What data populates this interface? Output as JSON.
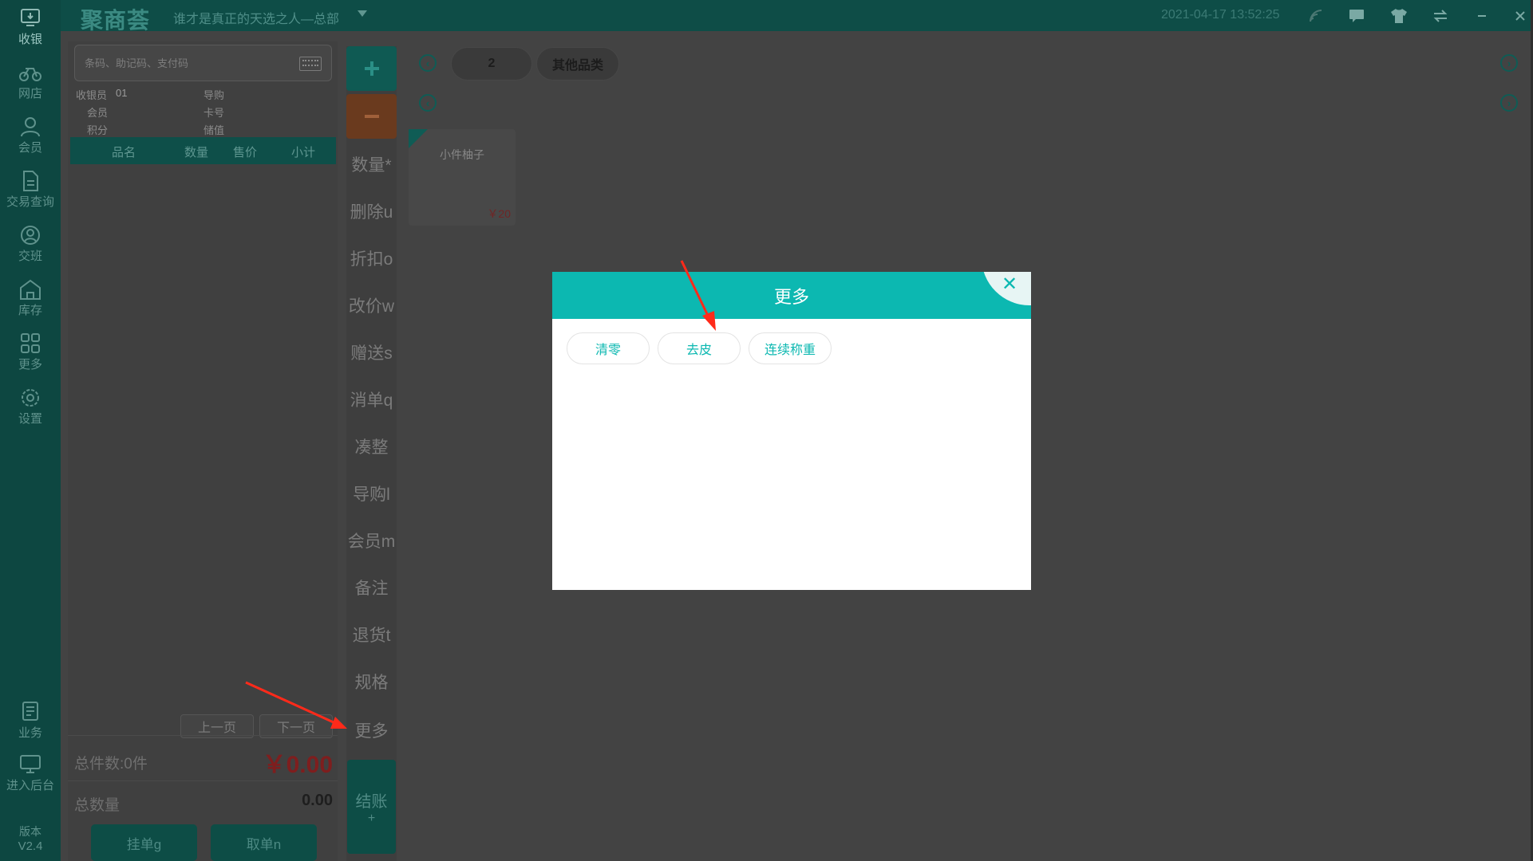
{
  "app": {
    "logo": "聚商荟",
    "store": "谁才是真正的天选之人—总部",
    "datetime": "2021-04-17 13:52:25"
  },
  "nav": [
    {
      "label": "收银",
      "icon": "cashier-icon"
    },
    {
      "label": "网店",
      "icon": "bike-icon"
    },
    {
      "label": "会员",
      "icon": "member-icon"
    },
    {
      "label": "交易查询",
      "icon": "document-icon"
    },
    {
      "label": "交班",
      "icon": "shift-icon"
    },
    {
      "label": "库存",
      "icon": "warehouse-icon"
    },
    {
      "label": "更多",
      "icon": "grid-icon"
    },
    {
      "label": "设置",
      "icon": "gear-icon"
    },
    {
      "label": "业务",
      "icon": "business-icon"
    },
    {
      "label": "进入后台",
      "icon": "monitor-icon"
    }
  ],
  "version": {
    "label": "版本",
    "value": "V2.4"
  },
  "cart": {
    "search_placeholder": "条码、助记码、支付码",
    "cashier_label": "收银员",
    "cashier_value": "01",
    "guide_label": "导购",
    "member_label": "会员",
    "card_label": "卡号",
    "points_label": "积分",
    "balance_label": "储值",
    "columns": [
      "品名",
      "数量",
      "售价",
      "小计"
    ],
    "prev_page": "上一页",
    "next_page": "下一页",
    "total_count": "总件数:0件",
    "total_price": "￥0.00",
    "total_qty_label": "总数量",
    "total_qty": "0.00",
    "hold_btn": "挂单g",
    "retrieve_btn": "取单n"
  },
  "actions": {
    "plus": "+",
    "minus": "−",
    "items": [
      "数量*",
      "删除u",
      "折扣o",
      "改价w",
      "赠送s",
      "消单q",
      "凑整",
      "导购l",
      "会员m",
      "备注",
      "退货t",
      "规格",
      "更多"
    ],
    "checkout": "结账",
    "checkout_sub": "+"
  },
  "categories": {
    "tabs": [
      "2",
      "其他品类"
    ]
  },
  "products": [
    {
      "name": "小件柚子",
      "price": "￥20"
    }
  ],
  "modal": {
    "title": "更多",
    "close": "✕",
    "options": [
      "清零",
      "去皮",
      "连续称重"
    ]
  },
  "colors": {
    "accent": "#0cb8b1",
    "annotation_arrow": "#ff2a1a"
  }
}
